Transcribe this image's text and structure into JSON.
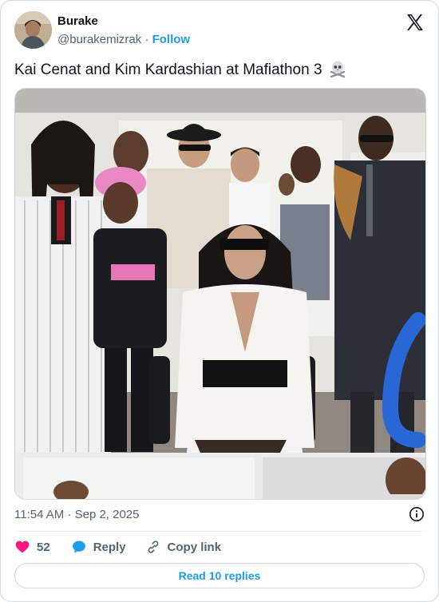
{
  "author": {
    "name": "Burake",
    "handle": "@burakemizrak",
    "separator": "·",
    "follow_label": "Follow"
  },
  "tweet": {
    "text": "Kai Cenat and Kim Kardashian at Mafiathon 3",
    "emoji_icon": "skull-crossbones-icon",
    "timestamp": "11:54 AM · Sep 2, 2025"
  },
  "actions": {
    "like_count": "52",
    "reply_label": "Reply",
    "copy_link_label": "Copy link"
  },
  "read_replies_label": "Read 10 replies",
  "colors": {
    "accent": "#1d9bf0",
    "like": "#f91880",
    "secondary_text": "#536471",
    "border": "#cfd9de"
  }
}
